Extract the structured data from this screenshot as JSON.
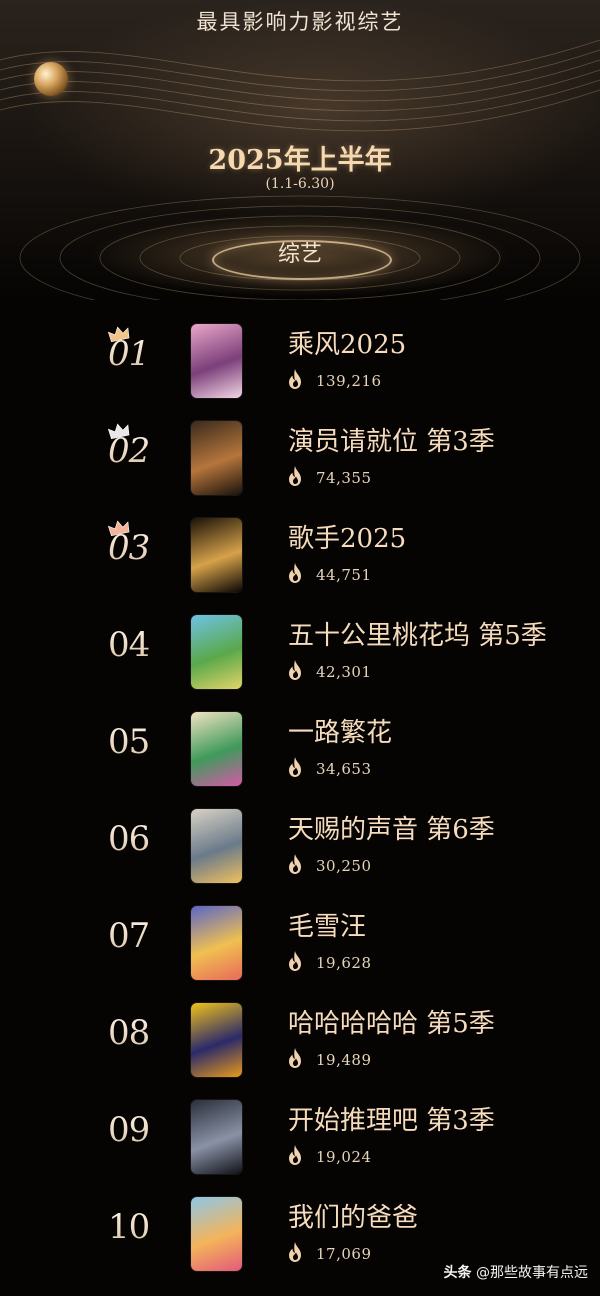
{
  "header": {
    "title": "最具影响力影视综艺",
    "period_title": "2025年上半年",
    "period_range": "(1.1-6.30)",
    "category": "综艺"
  },
  "ranking": [
    {
      "rank": "01",
      "title": "乘风2025",
      "heat": "139,216",
      "crown": "gold-crown-icon",
      "poster_colors": [
        "#e9a7c9",
        "#7b3f7a",
        "#f3d6e6"
      ]
    },
    {
      "rank": "02",
      "title": "演员请就位 第3季",
      "heat": "74,355",
      "crown": "silver-crown-icon",
      "poster_colors": [
        "#3a2a1c",
        "#b6763c",
        "#1a120c"
      ]
    },
    {
      "rank": "03",
      "title": "歌手2025",
      "heat": "44,751",
      "crown": "bronze-crown-icon",
      "poster_colors": [
        "#1a1208",
        "#d6a24a",
        "#0b0805"
      ]
    },
    {
      "rank": "04",
      "title": "五十公里桃花坞 第5季",
      "heat": "42,301",
      "crown": null,
      "poster_colors": [
        "#6fc2e6",
        "#5aa84a",
        "#e3d46a"
      ]
    },
    {
      "rank": "05",
      "title": "一路繁花",
      "heat": "34,653",
      "crown": null,
      "poster_colors": [
        "#f2e2c2",
        "#3f9a5a",
        "#d45aa8"
      ]
    },
    {
      "rank": "06",
      "title": "天赐的声音 第6季",
      "heat": "30,250",
      "crown": null,
      "poster_colors": [
        "#d9d2c6",
        "#6a7a8a",
        "#f0c060"
      ]
    },
    {
      "rank": "07",
      "title": "毛雪汪",
      "heat": "19,628",
      "crown": null,
      "poster_colors": [
        "#5a66c8",
        "#f0c050",
        "#e86a5a"
      ]
    },
    {
      "rank": "08",
      "title": "哈哈哈哈哈 第5季",
      "heat": "19,489",
      "crown": null,
      "poster_colors": [
        "#f2c21a",
        "#2a2a6a",
        "#e89a1a"
      ]
    },
    {
      "rank": "09",
      "title": "开始推理吧 第3季",
      "heat": "19,024",
      "crown": null,
      "poster_colors": [
        "#2a2f3a",
        "#8a92a6",
        "#101218"
      ]
    },
    {
      "rank": "10",
      "title": "我们的爸爸",
      "heat": "17,069",
      "crown": null,
      "poster_colors": [
        "#8fc6e8",
        "#f4b45a",
        "#e25a7a"
      ]
    }
  ],
  "watermark": {
    "platform": "头条",
    "account": "@那些故事有点远"
  },
  "colors": {
    "gold": "#f6dcbc",
    "crown_gold": "#f3c48a",
    "crown_silver": "#e8e8e8",
    "crown_bronze": "#f4b39a"
  }
}
